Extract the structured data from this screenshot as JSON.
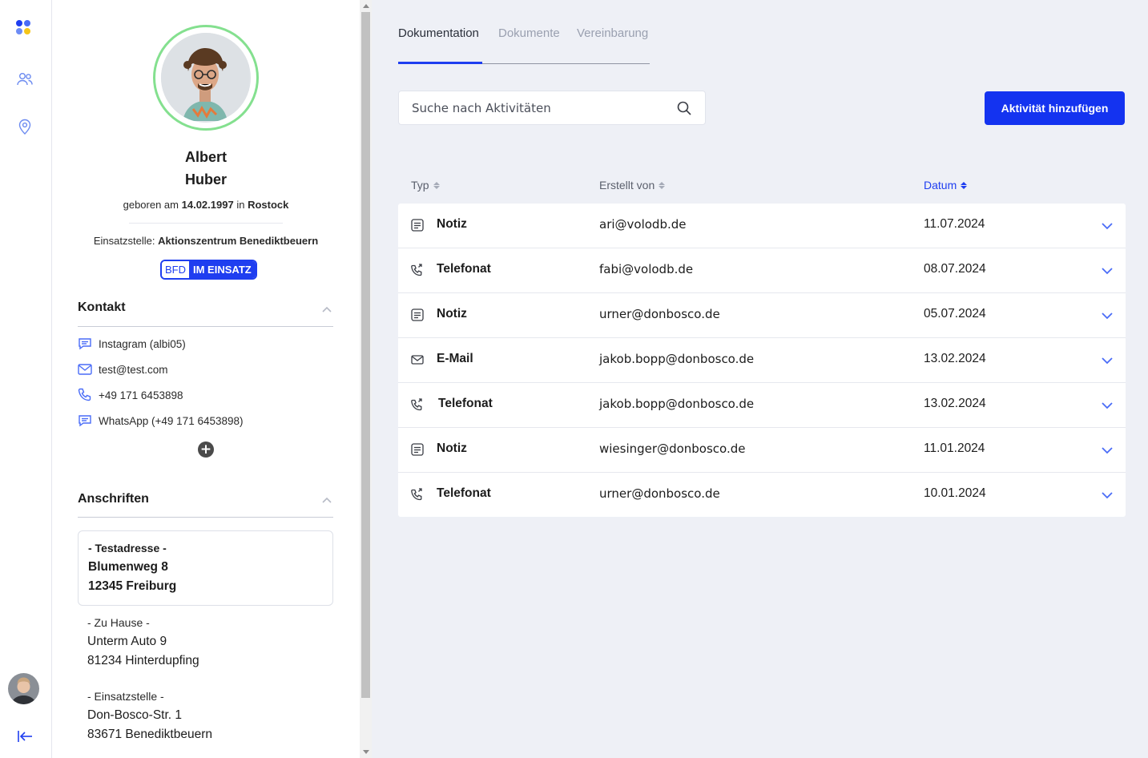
{
  "colors": {
    "accent": "#1f3ef0",
    "avatar_ring": "#84e08f",
    "main_bg": "#eef0f6"
  },
  "rail": {
    "items": [
      {
        "icon": "people-icon"
      },
      {
        "icon": "location-pin-icon"
      }
    ],
    "collapse_icon": "collapse-left-icon"
  },
  "profile": {
    "first_name": "Albert",
    "last_name": "Huber",
    "born_prefix": "geboren am",
    "birth_date": "14.02.1997",
    "born_in": "in",
    "birth_place": "Rostock",
    "einsatz_label": "Einsatzstelle:",
    "einsatz_value": "Aktionszentrum Benediktbeuern",
    "badge_program": "BFD",
    "badge_status": "IM EINSATZ"
  },
  "kontakt": {
    "title": "Kontakt",
    "items": [
      {
        "icon": "chat-icon",
        "label": "Instagram (albi05)"
      },
      {
        "icon": "mail-icon",
        "label": "test@test.com"
      },
      {
        "icon": "phone-icon",
        "label": "+49 171 6453898"
      },
      {
        "icon": "chat-icon",
        "label": "WhatsApp (+49 171 6453898)"
      }
    ]
  },
  "anschriften": {
    "title": "Anschriften",
    "primary": {
      "label": "- Testadresse -",
      "line1": "Blumenweg 8",
      "line2": "12345 Freiburg"
    },
    "others": [
      {
        "label": "- Zu Hause -",
        "line1": "Unterm Auto 9",
        "line2": "81234 Hinterdupfing"
      },
      {
        "label": "- Einsatzstelle -",
        "line1": "Don-Bosco-Str. 1",
        "line2": "83671 Benediktbeuern"
      }
    ]
  },
  "main": {
    "tabs": [
      {
        "label": "Dokumentation",
        "active": true
      },
      {
        "label": "Dokumente",
        "active": false
      },
      {
        "label": "Vereinbarung",
        "active": false
      }
    ],
    "search_placeholder": "Suche nach Aktivitäten",
    "add_button": "Aktivität hinzufügen",
    "columns": {
      "type": "Typ",
      "created_by": "Erstellt von",
      "date": "Datum"
    },
    "rows": [
      {
        "icon": "note-icon",
        "type": "Notiz",
        "by": "ari@volodb.de",
        "date": "11.07.2024"
      },
      {
        "icon": "phone-call-icon",
        "type": "Telefonat",
        "by": "fabi@volodb.de",
        "date": "08.07.2024"
      },
      {
        "icon": "note-icon",
        "type": "Notiz",
        "by": "urner@donbosco.de",
        "date": "05.07.2024"
      },
      {
        "icon": "mail-icon",
        "type": "E-Mail",
        "by": "jakob.bopp@donbosco.de",
        "date": "13.02.2024"
      },
      {
        "icon": "phone-call-icon",
        "type": "Telefonat",
        "by": "jakob.bopp@donbosco.de",
        "date": "13.02.2024"
      },
      {
        "icon": "note-icon",
        "type": "Notiz",
        "by": "wiesinger@donbosco.de",
        "date": "11.01.2024"
      },
      {
        "icon": "phone-call-icon",
        "type": "Telefonat",
        "by": "urner@donbosco.de",
        "date": "10.01.2024"
      }
    ]
  }
}
